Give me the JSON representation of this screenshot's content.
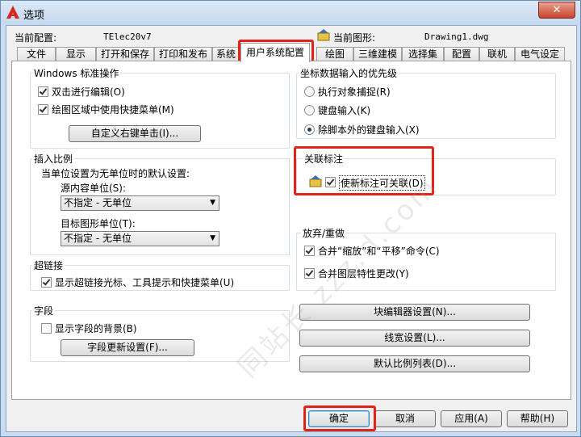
{
  "window": {
    "title": "选项",
    "close_label": "✕"
  },
  "header": {
    "current_profile_label": "当前配置:",
    "current_profile_value": "TElec20v7",
    "current_drawing_label": "当前图形:",
    "current_drawing_value": "Drawing1.dwg"
  },
  "tabs": [
    "文件",
    "显示",
    "打开和保存",
    "打印和发布",
    "系统",
    "用户系统配置",
    "绘图",
    "三维建模",
    "选择集",
    "配置",
    "联机",
    "电气设定"
  ],
  "windows_ops": {
    "title": "Windows 标准操作",
    "double_click_edit": "双击进行编辑(O)",
    "shortcut_menu": "绘图区域中使用快捷菜单(M)",
    "customize_button": "自定义右键单击(I)..."
  },
  "insert_scale": {
    "title": "插入比例",
    "desc": "当单位设置为无单位时的默认设置:",
    "source_label": "源内容单位(S):",
    "source_value": "不指定 - 无单位",
    "target_label": "目标图形单位(T):",
    "target_value": "不指定 - 无单位"
  },
  "hyperlink": {
    "title": "超链接",
    "show_cursor": "显示超链接光标、工具提示和快捷菜单(U)"
  },
  "fields": {
    "title": "字段",
    "show_background": "显示字段的背景(B)",
    "update_button": "字段更新设置(F)..."
  },
  "coord_priority": {
    "title": "坐标数据输入的优先级",
    "osnap": "执行对象捕捉(R)",
    "keyboard": "键盘输入(K)",
    "keyboard_except_script": "除脚本外的键盘输入(X)"
  },
  "assoc_dim": {
    "title": "关联标注",
    "make_assoc": "使新标注可关联(D)"
  },
  "undo_redo": {
    "title": "放弃/重做",
    "combine_zoom_pan": "合并“缩放”和“平移”命令(C)",
    "combine_layer": "合并图层特性更改(Y)"
  },
  "right_buttons": {
    "block_editor": "块编辑器设置(N)...",
    "lineweight": "线宽设置(L)...",
    "scale_list": "默认比例列表(D)..."
  },
  "footer": {
    "ok": "确定",
    "cancel": "取消",
    "apply": "应用(A)",
    "help": "帮助(H)"
  },
  "watermark": "同站长 zzz.d.com"
}
